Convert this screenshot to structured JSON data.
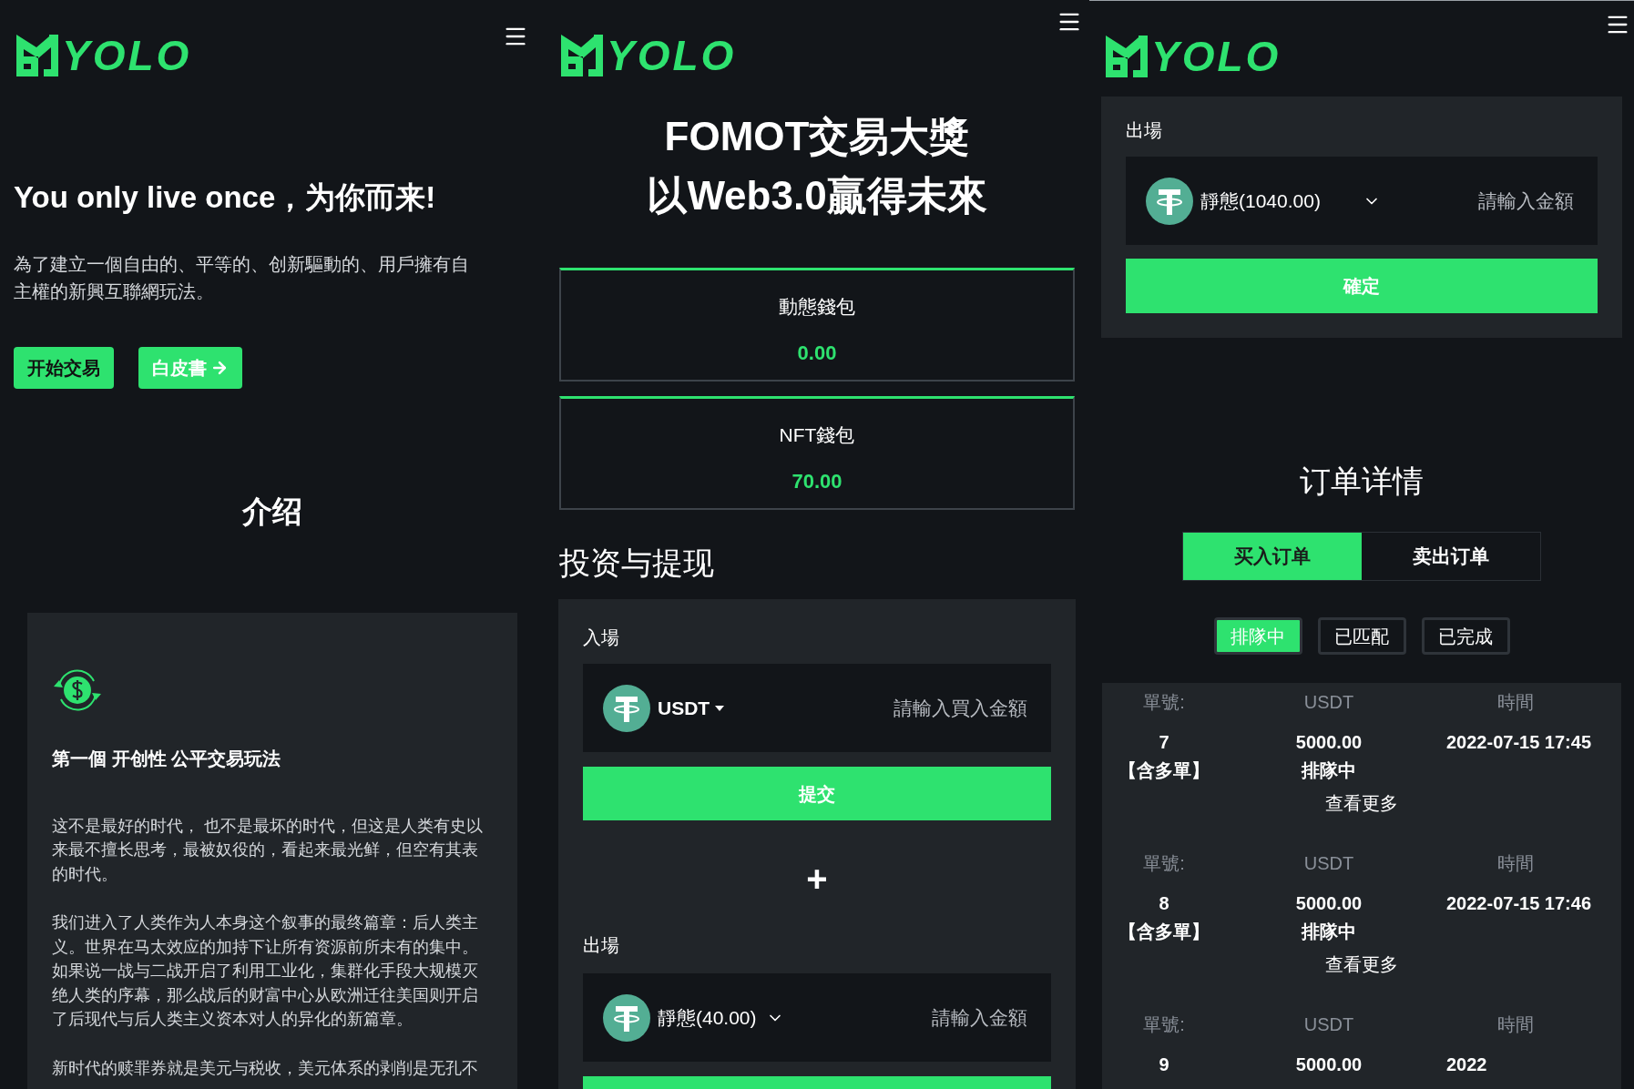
{
  "home": {
    "logo": "YOLO",
    "hero": {
      "title": "You only live once，为你而来!",
      "text": "為了建立一個自由的、平等的、创新驅動的、用戶擁有自主權的新興互聯網玩法。",
      "buttons": [
        {
          "label": "开始交易",
          "kind": "plain"
        },
        {
          "label": "白皮書",
          "kind": "arrow"
        }
      ]
    },
    "intro": {
      "title": "介绍",
      "heading": "第一個 开创性 公平交易玩法",
      "paragraphs": [
        "这不是最好的时代， 也不是最坏的时代，但这是人类有史以来最不擅长思考，最被奴役的，看起来最光鲜，但空有其表的时代。",
        "我们进入了人类作为人本身这个叙事的最终篇章：后人类主义。世界在马太效应的加持下让所有资源前所未有的集中。如果说一战与二战开启了利用工业化，集群化手段大规模灭绝人类的序幕，那么战后的财富中心从欧洲迁往美国则开启了后现代与后人类主义资本对人的异化的新篇章。",
        "新时代的赎罪券就是美元与税收，美元体系的剥削是无孔不"
      ]
    }
  },
  "wallet": {
    "logo": "YOLO",
    "title_lines": [
      "FOMOT交易大獎",
      "以Web3.0贏得未來"
    ],
    "wallets": [
      {
        "label": "動態錢包",
        "value": "0.00"
      },
      {
        "label": "NFT錢包",
        "value": "70.00"
      }
    ],
    "section_title": "投资与提现",
    "deposit": {
      "label": "入場",
      "currency": "USDT",
      "kind": "caret",
      "placeholder": "請輸入買入金額",
      "button": "提交"
    },
    "plus": "+",
    "withdraw": {
      "label": "出場",
      "currency": "靜態(40.00)",
      "kind": "chevron",
      "placeholder": "請輸入金額"
    }
  },
  "orders": {
    "logo": "YOLO",
    "withdraw": {
      "label": "出場",
      "currency": "靜態(1040.00)",
      "kind": "chevron",
      "placeholder": "請輸入金額",
      "button": "確定"
    },
    "title": "订单详情",
    "tabs": [
      {
        "label": "买入订单",
        "selected": true
      },
      {
        "label": "卖出订单",
        "selected": false
      }
    ],
    "filters": [
      {
        "label": "排隊中",
        "selected": true
      },
      {
        "label": "已匹配",
        "selected": false
      },
      {
        "label": "已完成",
        "selected": false
      }
    ],
    "rows": [
      {
        "headers": [
          "單號:",
          "USDT",
          "時間"
        ],
        "id": "7",
        "tag": "【含多單】",
        "amount": "5000.00",
        "status": "排隊中",
        "time": "2022-07-15 17:45",
        "more": "查看更多"
      },
      {
        "headers": [
          "單號:",
          "USDT",
          "時間"
        ],
        "id": "8",
        "tag": "【含多單】",
        "amount": "5000.00",
        "status": "排隊中",
        "time": "2022-07-15 17:46",
        "more": "查看更多"
      },
      {
        "headers": [
          "單號:",
          "USDT",
          "時間"
        ],
        "id": "9",
        "amount": "5000.00",
        "time": "2022"
      }
    ]
  }
}
